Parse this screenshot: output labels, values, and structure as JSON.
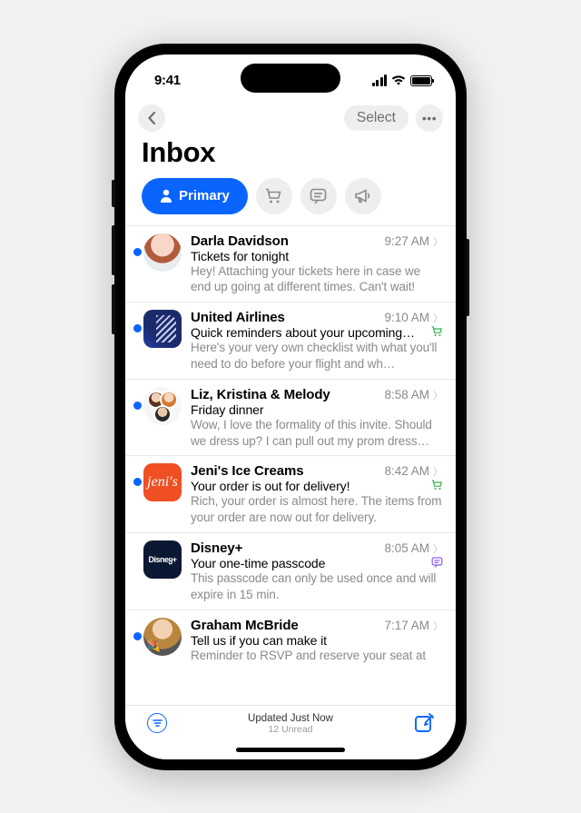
{
  "statusbar": {
    "time": "9:41"
  },
  "nav": {
    "select_label": "Select"
  },
  "title": "Inbox",
  "tabs": {
    "primary_label": "Primary"
  },
  "emails": [
    {
      "sender": "Darla Davidson",
      "time": "9:27 AM",
      "subject": "Tickets for tonight",
      "preview": "Hey! Attaching your tickets here in case we end up going at different times. Can't wait!",
      "unread": true,
      "avatar_style": "av-darla",
      "avatar_shape": "circle",
      "category_icon": ""
    },
    {
      "sender": "United Airlines",
      "time": "9:10 AM",
      "subject": "Quick reminders about your upcoming…",
      "preview": "Here's your very own checklist with what you'll need to do before your flight and wh…",
      "unread": true,
      "avatar_style": "av-united",
      "avatar_shape": "squircle",
      "category_icon": "cart",
      "category_color": "#33b24a"
    },
    {
      "sender": "Liz, Kristina & Melody",
      "time": "8:58 AM",
      "subject": "Friday dinner",
      "preview": "Wow, I love the formality of this invite. Should we dress up? I can pull out my prom dress…",
      "unread": true,
      "avatar_style": "av-group",
      "avatar_shape": "circle",
      "category_icon": ""
    },
    {
      "sender": "Jeni's Ice Creams",
      "time": "8:42 AM",
      "subject": "Your order is out for delivery!",
      "preview": "Rich, your order is almost here. The items from your order are now out for delivery.",
      "unread": true,
      "avatar_style": "av-jenis",
      "avatar_shape": "squircle",
      "avatar_text": "jeni's",
      "category_icon": "cart",
      "category_color": "#33b24a"
    },
    {
      "sender": "Disney+",
      "time": "8:05 AM",
      "subject": "Your one-time passcode",
      "preview": "This passcode can only be used once and will expire in 15 min.",
      "unread": false,
      "avatar_style": "av-disney",
      "avatar_shape": "squircle",
      "avatar_text": "Disneყ+",
      "category_icon": "chat",
      "category_color": "#8a5cf0"
    },
    {
      "sender": "Graham McBride",
      "time": "7:17 AM",
      "subject": "Tell us if you can make it",
      "preview": "Reminder to RSVP and reserve your seat at",
      "unread": true,
      "avatar_style": "av-graham",
      "avatar_shape": "circle",
      "category_icon": ""
    }
  ],
  "toolbar": {
    "status_line1": "Updated Just Now",
    "status_line2": "12 Unread"
  }
}
